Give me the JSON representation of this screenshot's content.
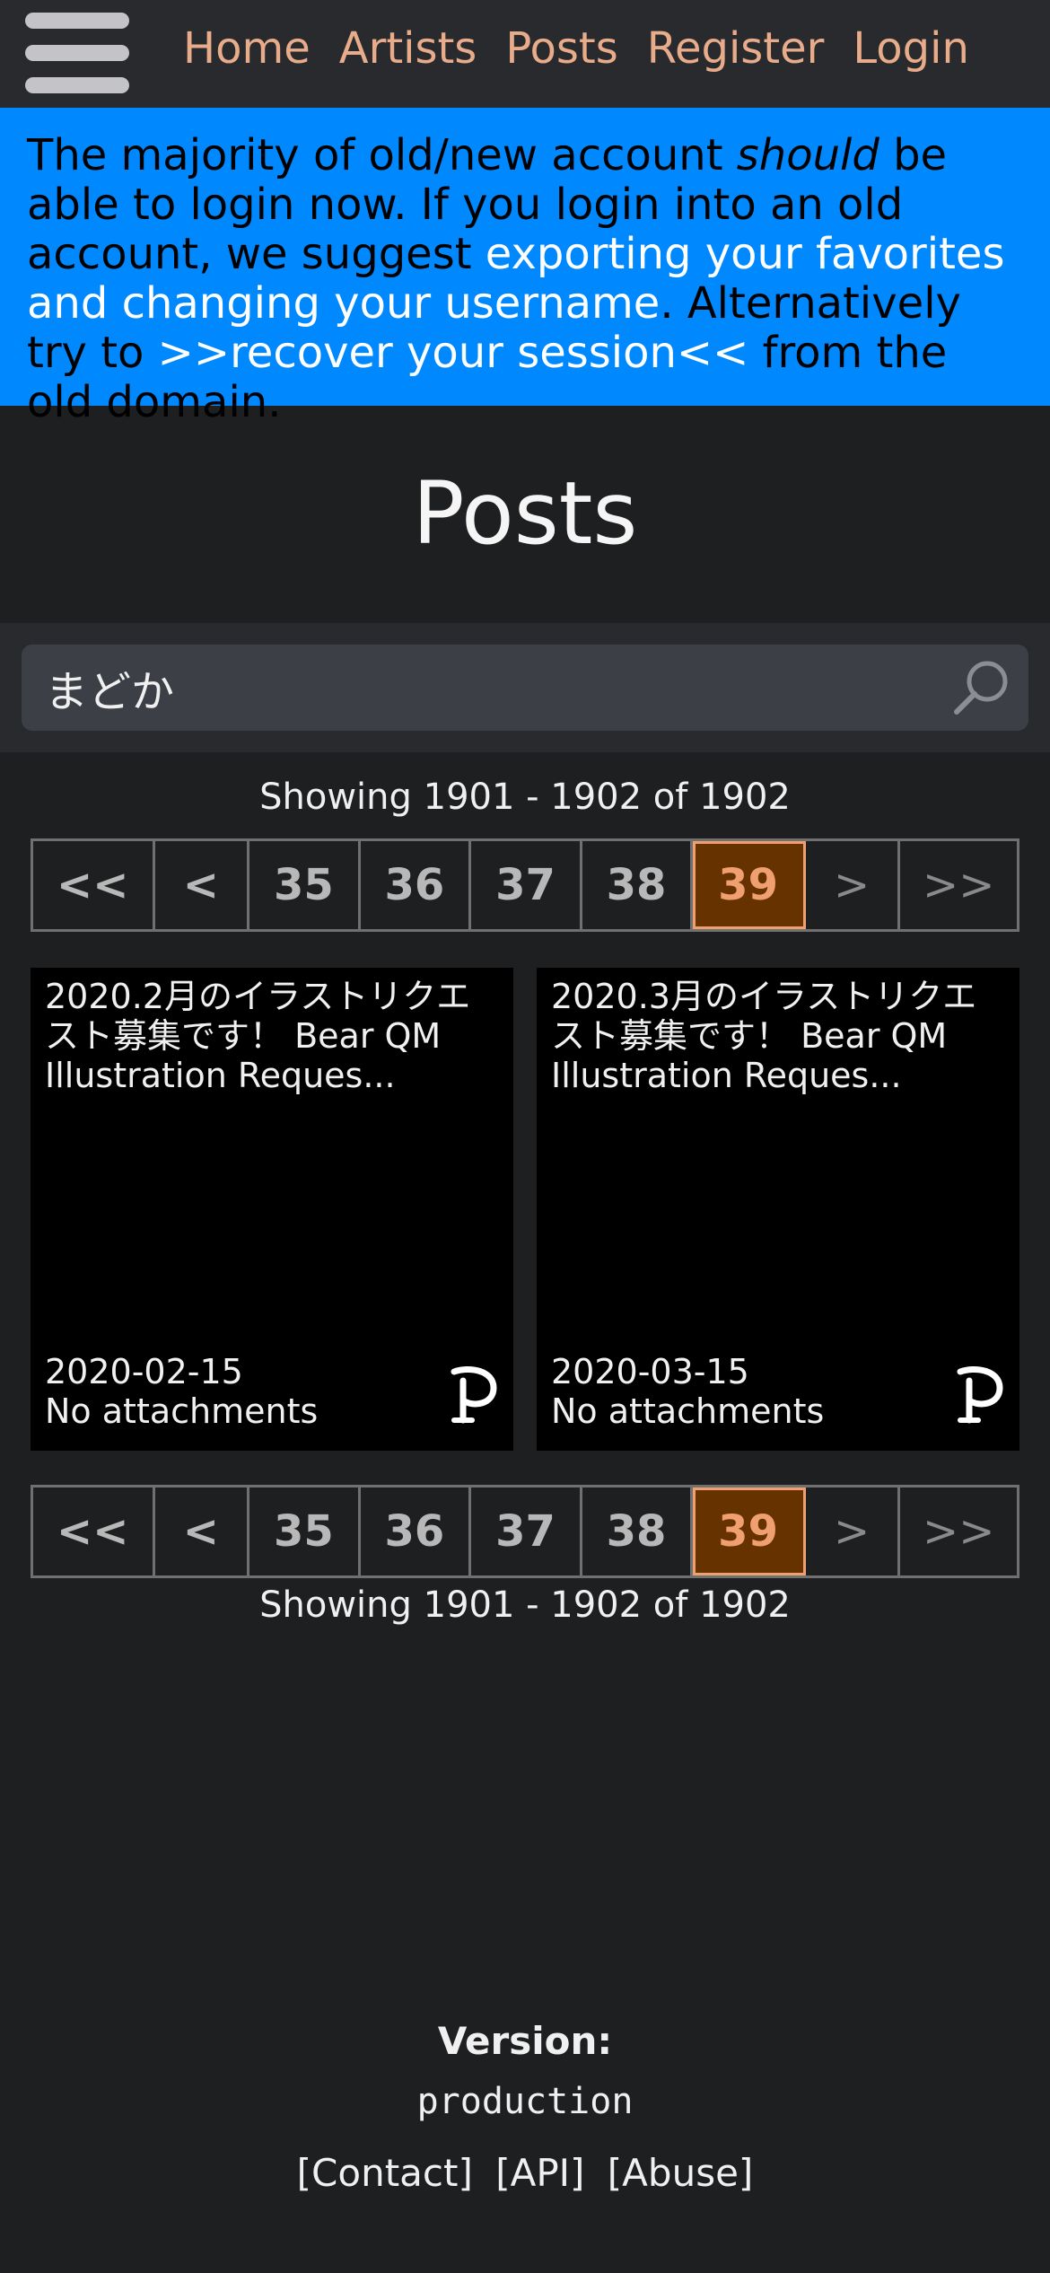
{
  "nav": {
    "items": [
      "Home",
      "Artists",
      "Posts",
      "Register",
      "Login"
    ]
  },
  "banner": {
    "part1": "The majority of old/new account ",
    "em": "should",
    "part2": " be able to login now. If you login into an old account, we suggest ",
    "link1": "exporting your favorites and changing your username",
    "part3": ". Alternatively try to ",
    "link2": ">>recover your session<<",
    "part4": " from the old domain."
  },
  "page_title": "Posts",
  "search": {
    "value": "まどか",
    "placeholder": ""
  },
  "showing": "Showing 1901 - 1902 of 1902",
  "pagination": {
    "first": "<<",
    "prev": "<",
    "pages": [
      "35",
      "36",
      "37",
      "38",
      "39"
    ],
    "current": "39",
    "next": ">",
    "last": ">>"
  },
  "posts": [
    {
      "title": "2020.2月のイラストリクエスト募集です！ Bear QM Illustration Reques...",
      "date": "2020-02-15",
      "attachments": "No attachments",
      "service_icon": "pixiv-fanbox-icon"
    },
    {
      "title": "2020.3月のイラストリクエスト募集です！ Bear QM Illustration Reques...",
      "date": "2020-03-15",
      "attachments": "No attachments",
      "service_icon": "pixiv-fanbox-icon"
    }
  ],
  "footer": {
    "version_label": "Version:",
    "version_value": "production",
    "links": [
      "[Contact]",
      "[API]",
      "[Abuse]"
    ]
  }
}
